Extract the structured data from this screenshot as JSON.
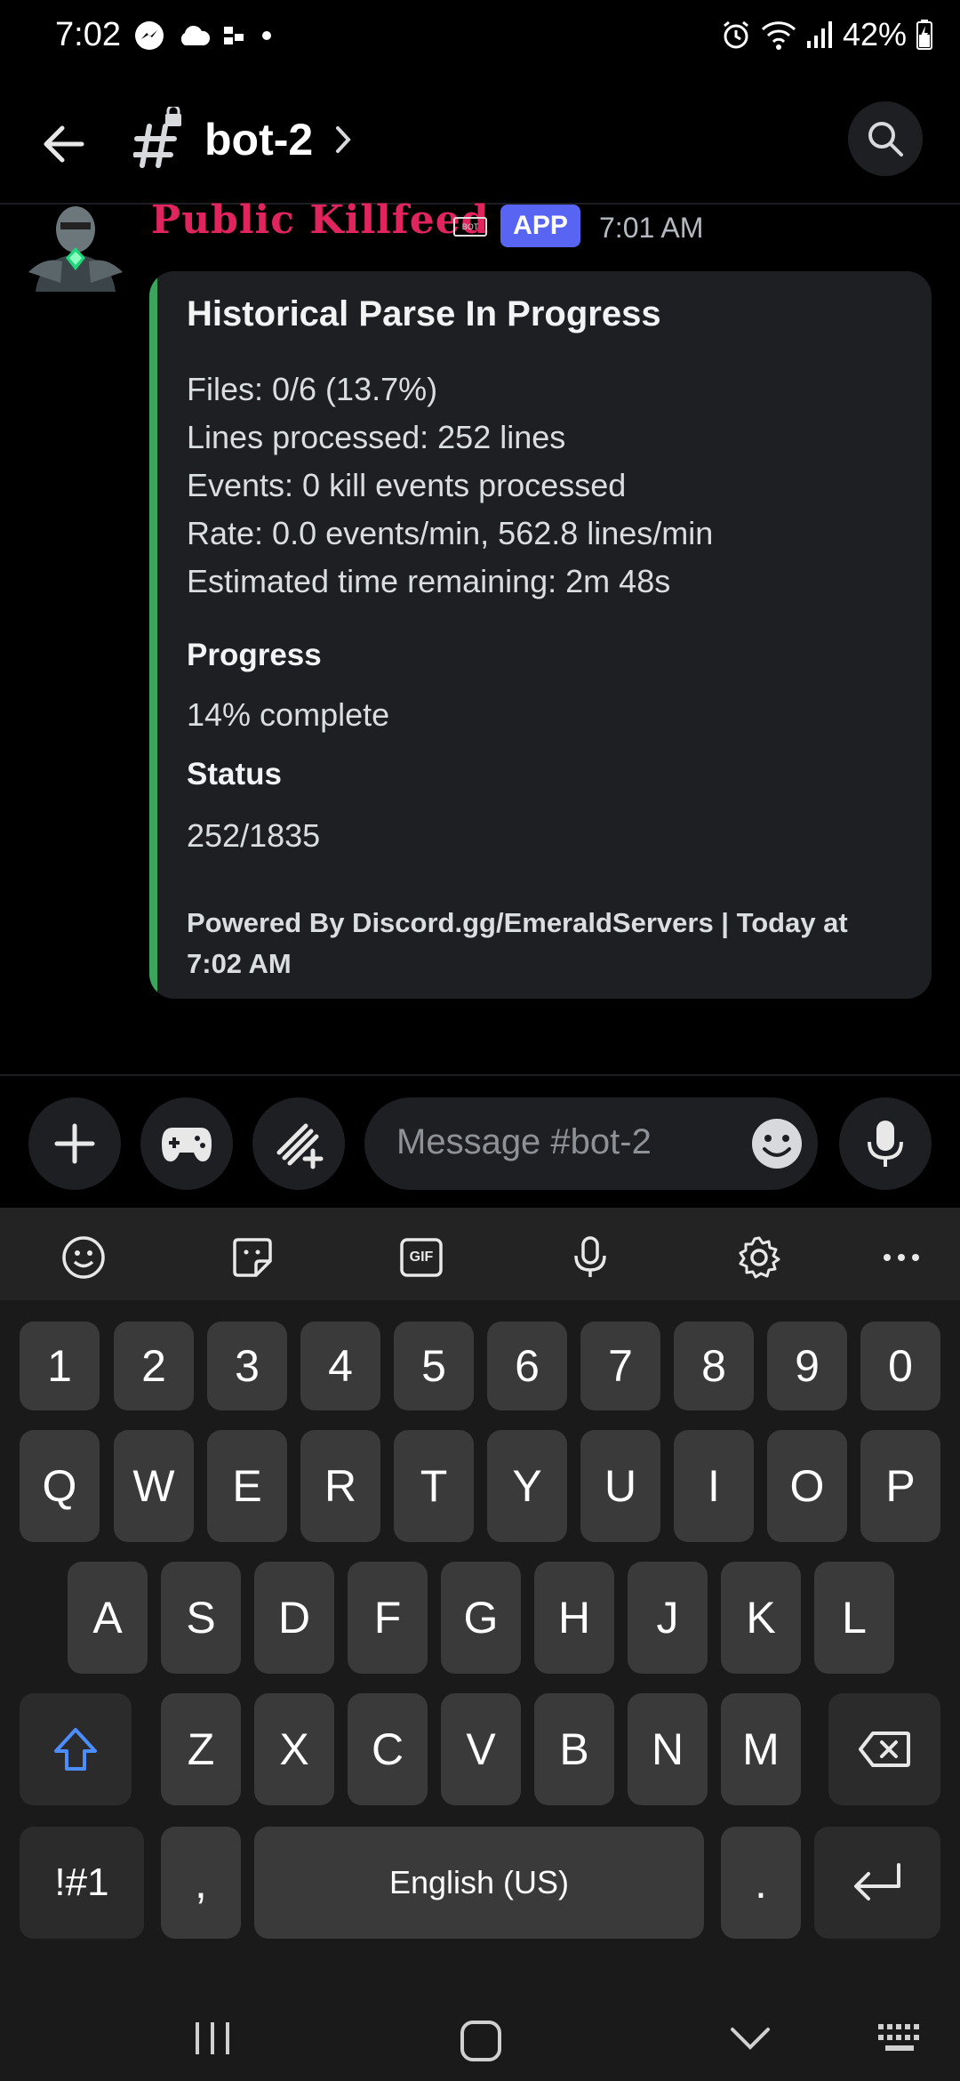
{
  "status_bar": {
    "time": "7:02",
    "battery": "42%"
  },
  "header": {
    "channel_name": "bot-2"
  },
  "message": {
    "author": "Public Killfeed",
    "bot_tag": "BOT",
    "app_badge": "APP",
    "timestamp": "7:01 AM",
    "embed": {
      "accent_color": "#3ba55c",
      "title": "Historical Parse In Progress",
      "lines": [
        "Files: 0/6 (13.7%)",
        "Lines processed: 252 lines",
        "Events: 0 kill events processed",
        "Rate: 0.0 events/min, 562.8 lines/min",
        "Estimated time remaining: 2m 48s"
      ],
      "fields": [
        {
          "name": "Progress",
          "value": "14% complete"
        },
        {
          "name": "Status",
          "value": "252/1835"
        }
      ],
      "footer": "Powered By Discord.gg/EmeraldServers | Today at 7:02 AM"
    }
  },
  "composer": {
    "placeholder": "Message #bot-2"
  },
  "keyboard": {
    "toolbar_icons": [
      "emoji-icon",
      "sticker-icon",
      "gif-icon",
      "voice-icon",
      "settings-icon",
      "more-icon"
    ],
    "gif_label": "GIF",
    "row_numbers": [
      "1",
      "2",
      "3",
      "4",
      "5",
      "6",
      "7",
      "8",
      "9",
      "0"
    ],
    "row_q": [
      "Q",
      "W",
      "E",
      "R",
      "T",
      "Y",
      "U",
      "I",
      "O",
      "P"
    ],
    "row_a": [
      "A",
      "S",
      "D",
      "F",
      "G",
      "H",
      "J",
      "K",
      "L"
    ],
    "row_z": [
      "Z",
      "X",
      "C",
      "V",
      "B",
      "N",
      "M"
    ],
    "symbols_key": "!#1",
    "comma_key": ",",
    "space_key": "English (US)",
    "period_key": "."
  }
}
